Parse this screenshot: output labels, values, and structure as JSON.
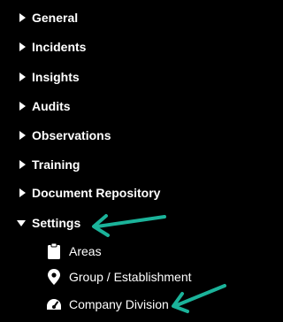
{
  "nav": {
    "items": [
      {
        "label": "General",
        "icon": "caret-right-icon"
      },
      {
        "label": "Incidents",
        "icon": "caret-right-icon"
      },
      {
        "label": "Insights",
        "icon": "caret-right-icon"
      },
      {
        "label": "Audits",
        "icon": "caret-right-icon"
      },
      {
        "label": "Observations",
        "icon": "caret-right-icon"
      },
      {
        "label": "Training",
        "icon": "caret-right-icon"
      },
      {
        "label": "Document Repository",
        "icon": "caret-right-icon"
      },
      {
        "label": "Settings",
        "icon": "caret-down-icon",
        "expanded": true
      }
    ],
    "settings_children": [
      {
        "label": "Areas",
        "icon": "clipboard-icon"
      },
      {
        "label": "Group / Establishment",
        "icon": "map-marker-icon"
      },
      {
        "label": "Company Division",
        "icon": "dashboard-icon"
      }
    ]
  },
  "colors": {
    "background": "#000000",
    "text": "#ffffff",
    "annotation_arrow": "#1bb39a"
  }
}
